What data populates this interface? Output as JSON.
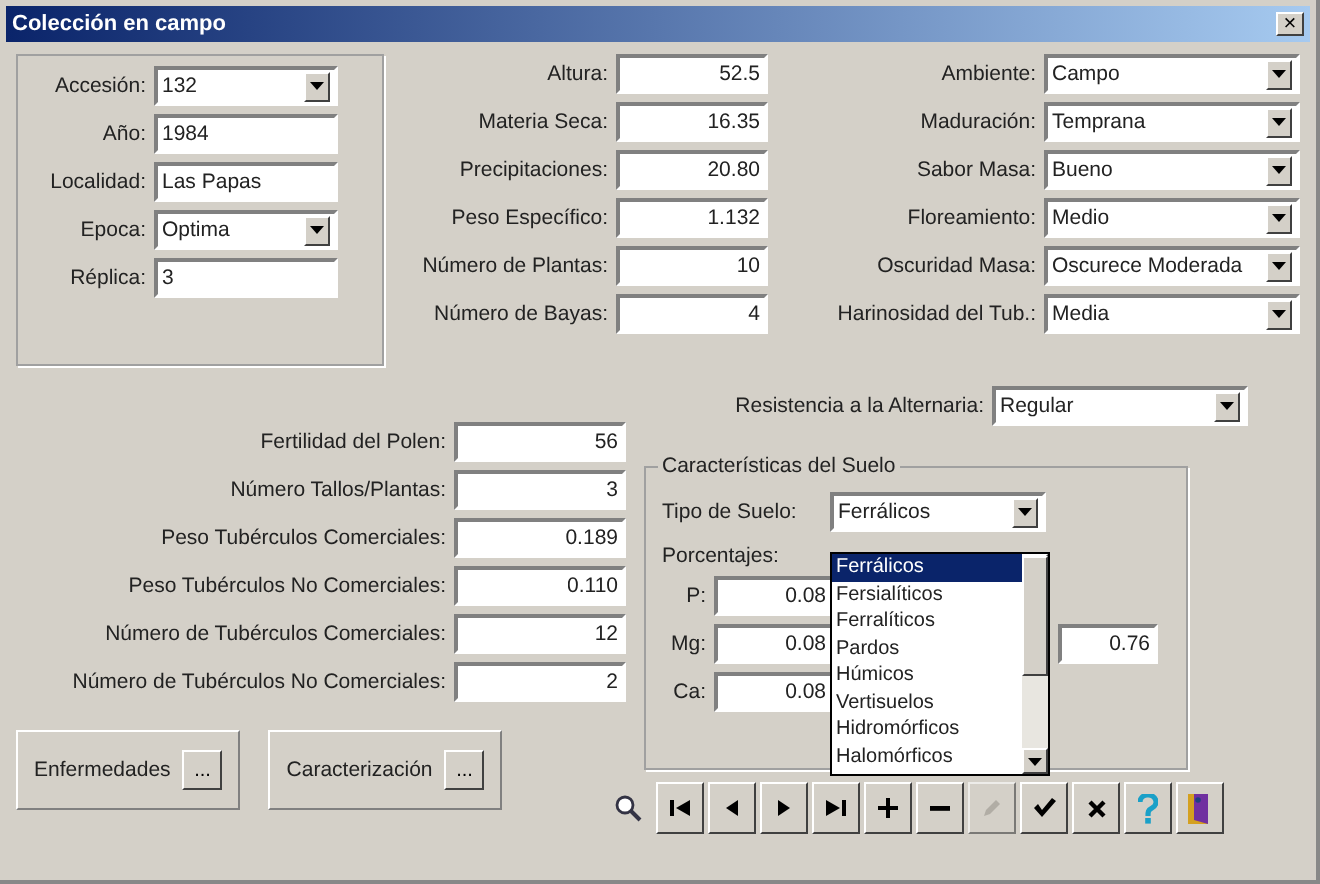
{
  "window": {
    "title": "Colección en campo",
    "close": "×"
  },
  "general": [
    {
      "label": "Accesión:",
      "value": "132",
      "kind": "combo"
    },
    {
      "label": "Año:",
      "value": "1984",
      "kind": "text"
    },
    {
      "label": "Localidad:",
      "value": "Las Papas",
      "kind": "text"
    },
    {
      "label": "Epoca:",
      "value": "Optima",
      "kind": "combo"
    },
    {
      "label": "Réplica:",
      "value": "3",
      "kind": "text"
    }
  ],
  "measures": [
    {
      "label": "Altura:",
      "value": "52.5"
    },
    {
      "label": "Materia Seca:",
      "value": "16.35"
    },
    {
      "label": "Precipitaciones:",
      "value": "20.80"
    },
    {
      "label": "Peso Específico:",
      "value": "1.132"
    },
    {
      "label": "Número de Plantas:",
      "value": "10"
    },
    {
      "label": "Número de Bayas:",
      "value": "4"
    }
  ],
  "traits": [
    {
      "label": "Ambiente:",
      "value": "Campo"
    },
    {
      "label": "Maduración:",
      "value": "Temprana"
    },
    {
      "label": "Sabor Masa:",
      "value": "Bueno"
    },
    {
      "label": "Floreamiento:",
      "value": "Medio"
    },
    {
      "label": "Oscuridad Masa:",
      "value": "Oscurece Moderada"
    },
    {
      "label": "Harinosidad del Tub.:",
      "value": "Media"
    },
    {
      "label": "Resistencia a la Alternaria:",
      "value": "Regular"
    }
  ],
  "tubers": [
    {
      "label": "Fertilidad del Polen:",
      "value": "56"
    },
    {
      "label": "Número Tallos/Plantas:",
      "value": "3"
    },
    {
      "label": "Peso Tubérculos Comerciales:",
      "value": "0.189"
    },
    {
      "label": "Peso Tubérculos No Comerciales:",
      "value": "0.110"
    },
    {
      "label": "Número de Tubérculos Comerciales:",
      "value": "12"
    },
    {
      "label": "Número de Tubérculos No Comerciales:",
      "value": "2"
    }
  ],
  "buttons": [
    {
      "label": "Enfermedades",
      "ellipsis": "..."
    },
    {
      "label": "Caracterización",
      "ellipsis": "..."
    }
  ],
  "soil": {
    "title": "Características del Suelo",
    "type_label": "Tipo de Suelo:",
    "type_value": "Ferrálicos",
    "percent_label": "Porcentajes:",
    "fields": [
      {
        "label": "P:",
        "value": "0.08"
      },
      {
        "label": "Mg:",
        "value": "0.08"
      },
      {
        "label": "Ca:",
        "value": "0.08"
      }
    ],
    "extra_value": "0.76",
    "options": [
      {
        "label": "Ferrálicos",
        "selected": true
      },
      {
        "label": "Fersialíticos",
        "selected": false
      },
      {
        "label": "Ferralíticos",
        "selected": false
      },
      {
        "label": "Pardos",
        "selected": false
      },
      {
        "label": "Húmicos",
        "selected": false
      },
      {
        "label": "Vertisuelos",
        "selected": false
      },
      {
        "label": "Hidromórficos",
        "selected": false
      },
      {
        "label": "Halomórficos",
        "selected": false
      }
    ]
  },
  "toolbar": [
    {
      "kind": "zoom",
      "disabled": false
    },
    {
      "kind": "first",
      "disabled": false
    },
    {
      "kind": "prev",
      "disabled": false
    },
    {
      "kind": "next",
      "disabled": false
    },
    {
      "kind": "last",
      "disabled": false
    },
    {
      "kind": "add",
      "disabled": false
    },
    {
      "kind": "remove",
      "disabled": false
    },
    {
      "kind": "edit",
      "disabled": true
    },
    {
      "kind": "accept",
      "disabled": false
    },
    {
      "kind": "cancel",
      "disabled": false
    },
    {
      "kind": "help",
      "disabled": false
    },
    {
      "kind": "exit",
      "disabled": false
    }
  ]
}
